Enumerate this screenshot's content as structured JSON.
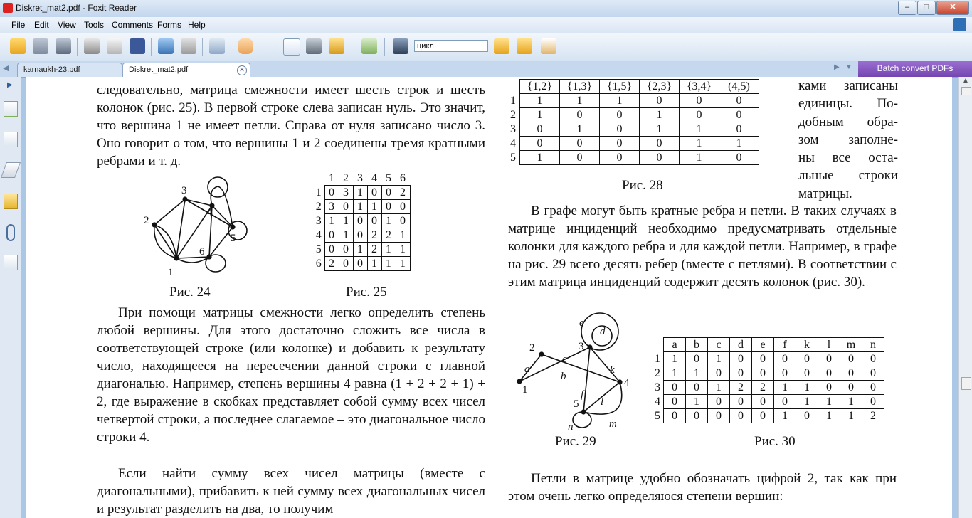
{
  "window": {
    "title": "Diskret_mat2.pdf - Foxit Reader"
  },
  "menu": [
    "File",
    "Edit",
    "View",
    "Tools",
    "Comments",
    "Forms",
    "Help"
  ],
  "toolbar": {
    "search_value": "цикл"
  },
  "tabs": [
    {
      "label": "karnaukh-23.pdf",
      "active": false
    },
    {
      "label": "Diskret_mat2.pdf",
      "active": true
    }
  ],
  "batch_button": "Batch convert PDFs",
  "left": {
    "para1": "следовательно, матрица смежности имеет шесть строк и шесть колонок (рис. 25). В первой строке слева записан нуль. Это значит, что вершина 1 не имеет петли. Справа от нуля записано число 3. Оно говорит о том, что вершины 1 и 2 соединены тремя кратными ребрами и т. д.",
    "caption24": "Рис. 24",
    "caption25": "Рис. 25",
    "graph24_labels": [
      "1",
      "2",
      "3",
      "4",
      "5",
      "6"
    ],
    "matrix25": {
      "cols": [
        "1",
        "2",
        "3",
        "4",
        "5",
        "6"
      ],
      "rows": [
        {
          "label": "1",
          "cells": [
            "0",
            "3",
            "1",
            "0",
            "0",
            "2"
          ]
        },
        {
          "label": "2",
          "cells": [
            "3",
            "0",
            "1",
            "1",
            "0",
            "0"
          ]
        },
        {
          "label": "3",
          "cells": [
            "1",
            "1",
            "0",
            "0",
            "1",
            "0"
          ]
        },
        {
          "label": "4",
          "cells": [
            "0",
            "1",
            "0",
            "2",
            "2",
            "1"
          ]
        },
        {
          "label": "5",
          "cells": [
            "0",
            "0",
            "1",
            "2",
            "1",
            "1"
          ]
        },
        {
          "label": "6",
          "cells": [
            "2",
            "0",
            "0",
            "1",
            "1",
            "1"
          ]
        }
      ]
    },
    "para2": "При помощи матрицы смежности легко определить степень любой вершины. Для этого достаточно сложить все числа в соответствующей строке (или колонке) и добавить к результату число, находящееся на пересечении данной строки с главной диагональю. Например, степень вершины 4 равна (1 + 2 + 2 + 1) + 2, где выражение в скобках представляет собой сумму всех чисел четвертой строки, а последнее слагаемое – это диагональное число строки 4.",
    "para3": "Если найти сумму всех чисел матрицы (вместе с диагональными), прибавить к ней сумму всех диагональных чисел и результат разделить на два, то получим"
  },
  "right": {
    "matrix28": {
      "cols": [
        "{1,2}",
        "{1,3}",
        "{1,5}",
        "{2,3}",
        "{3,4}",
        "(4,5)"
      ],
      "rows": [
        {
          "label": "1",
          "cells": [
            "1",
            "1",
            "1",
            "0",
            "0",
            "0"
          ]
        },
        {
          "label": "2",
          "cells": [
            "1",
            "0",
            "0",
            "1",
            "0",
            "0"
          ]
        },
        {
          "label": "3",
          "cells": [
            "0",
            "1",
            "0",
            "1",
            "1",
            "0"
          ]
        },
        {
          "label": "4",
          "cells": [
            "0",
            "0",
            "0",
            "0",
            "1",
            "1"
          ]
        },
        {
          "label": "5",
          "cells": [
            "1",
            "0",
            "0",
            "0",
            "1",
            "0"
          ]
        }
      ]
    },
    "side_text": [
      "ками записаны",
      "единицы. По-",
      "добным обра-",
      "зом заполне-",
      "ны все оста-",
      "льные строки",
      "матрицы."
    ],
    "caption28": "Рис. 28",
    "para4": "В графе могут быть кратные ребра и петли. В таких случаях в матрице инциденций необходимо предусматривать отдельные колонки для каждого ребра и для каждой петли. Например, в графе на рис. 29 всего десять ребер (вместе с петлями). В соответствии с этим матрица инциденций содержит десять колонок (рис. 30).",
    "graph29_vertices": [
      "1",
      "2",
      "3",
      "4",
      "5"
    ],
    "graph29_edges": [
      "a",
      "b",
      "c",
      "d",
      "e",
      "f",
      "k",
      "l",
      "m",
      "n"
    ],
    "caption29": "Рис. 29",
    "caption30": "Рис. 30",
    "matrix30": {
      "cols": [
        "a",
        "b",
        "c",
        "d",
        "e",
        "f",
        "k",
        "l",
        "m",
        "n"
      ],
      "rows": [
        {
          "label": "1",
          "cells": [
            "1",
            "0",
            "1",
            "0",
            "0",
            "0",
            "0",
            "0",
            "0",
            "0"
          ]
        },
        {
          "label": "2",
          "cells": [
            "1",
            "1",
            "0",
            "0",
            "0",
            "0",
            "0",
            "0",
            "0",
            "0"
          ]
        },
        {
          "label": "3",
          "cells": [
            "0",
            "0",
            "1",
            "2",
            "2",
            "1",
            "1",
            "0",
            "0",
            "0"
          ]
        },
        {
          "label": "4",
          "cells": [
            "0",
            "1",
            "0",
            "0",
            "0",
            "0",
            "1",
            "1",
            "1",
            "0"
          ]
        },
        {
          "label": "5",
          "cells": [
            "0",
            "0",
            "0",
            "0",
            "0",
            "1",
            "0",
            "1",
            "1",
            "2"
          ]
        }
      ]
    },
    "para5": "Петли в матрице удобно обозначать цифрой 2, так как при этом очень легко определяюся степени вершин:"
  }
}
